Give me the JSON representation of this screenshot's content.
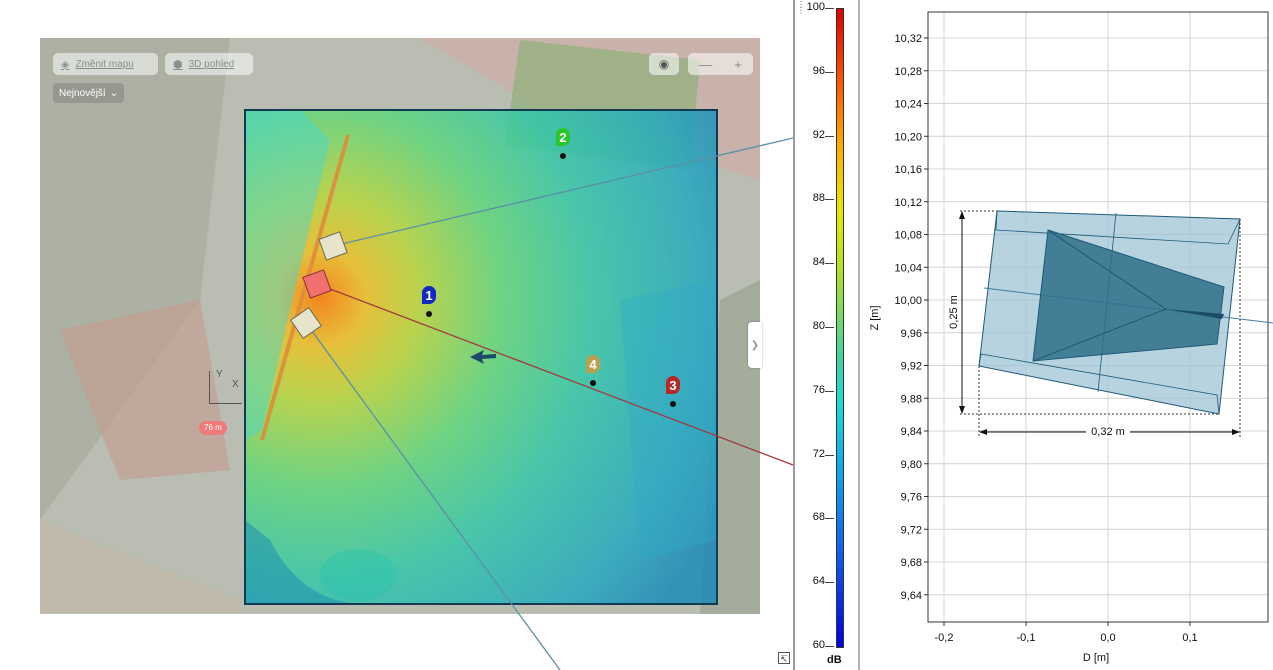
{
  "map": {
    "change_map_label": "Změnit mapu",
    "view_3d_label": "3D pohled",
    "recent_label": "Nejnovější",
    "camera_icon": "camera-icon",
    "zoom_minus": "—",
    "zoom_plus": "+",
    "expand_arrow": "❯",
    "distance_badge": "76 m",
    "gizmo_y": "Y",
    "gizmo_x": "X",
    "corner_glyph": "↸",
    "heatmap_colors": {
      "hot": "#ff7a00",
      "warm": "#c8e030",
      "mid": "#3cd2a0",
      "cool": "#18a8c8"
    },
    "markers": [
      {
        "label": "1",
        "color": "#1428c8"
      },
      {
        "label": "2",
        "color": "#28c828"
      },
      {
        "label": "3",
        "color": "#b82828"
      },
      {
        "label": "4",
        "color": "#b8a050"
      }
    ]
  },
  "colorbar": {
    "ticks": [
      "100",
      "96",
      "92",
      "88",
      "84",
      "80",
      "76",
      "72",
      "68",
      "64",
      "60"
    ],
    "unit": "dB",
    "max": 100,
    "min": 60
  },
  "chart": {
    "y_ticks": [
      "10,32",
      "10,28",
      "10,24",
      "10,20",
      "10,16",
      "10,12",
      "10,08",
      "10,04",
      "10,00",
      "9,96",
      "9,92",
      "9,88",
      "9,84",
      "9,80",
      "9,76",
      "9,72",
      "9,68",
      "9,64"
    ],
    "x_ticks": [
      "-0,2",
      "-0,1",
      "0,0",
      "0,1"
    ],
    "x_axis_label": "D [m]",
    "y_axis_label": "Z [m]",
    "height_dim_label": "0,25 m",
    "width_dim_label": "0,32 m",
    "fill_light": "#9fc4d6",
    "fill_dark": "#2f6f8a",
    "stroke": "#1d5a78"
  }
}
